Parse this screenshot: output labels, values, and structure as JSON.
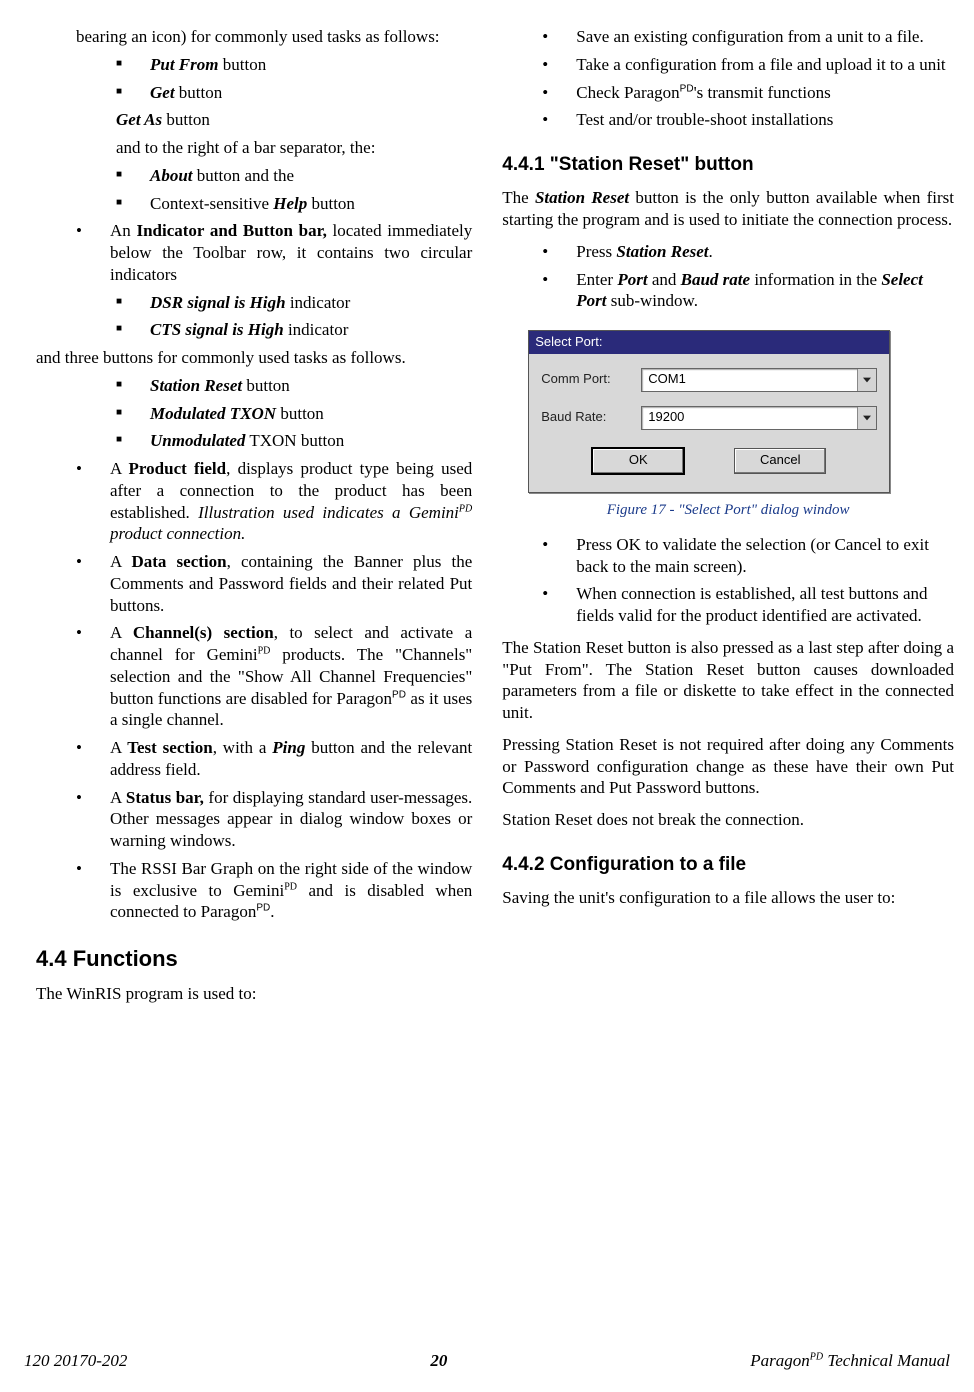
{
  "left": {
    "intro": "bearing an icon) for commonly used tasks as follows:",
    "sq_items": [
      {
        "html": "<span class='bi'>Put From</span> button"
      },
      {
        "html": "<span class='bi'>Get</span> button"
      }
    ],
    "plain1": {
      "html": "<span class='bi'>Get As</span> button"
    },
    "plain2": "and to the right of a bar separator, the:",
    "sq_items2": [
      {
        "html": "<span class='bi'>About</span> button and the"
      },
      {
        "html": "Context-sensitive <span class='bi'>Help</span> button"
      }
    ],
    "bullet1": {
      "html": "An <b>Indicator and Button bar,</b> located immediately below the Toolbar row, it contains two circular indicators"
    },
    "sq_items3": [
      {
        "html": "<span class='bi'>DSR signal is High</span> indicator"
      },
      {
        "html": "<span class='bi'>CTS signal is High</span> indicator"
      }
    ],
    "plain3": "and three buttons for commonly used tasks as follows.",
    "sq_items4": [
      {
        "html": "<span class='bi'>Station Reset</span> button"
      },
      {
        "html": "<span class='bi'>Modulated TXON</span> button"
      },
      {
        "html": "<span class='bi'>Unmodulated</span> TXON button"
      }
    ],
    "bullets_rest": [
      {
        "html": "A <b>Product field</b>, displays product type being used after a connection to the product has been established. <i>Illustration used indicates a Gemini<sup class='pd'>PD</sup> product connection.</i>"
      },
      {
        "html": "A <b>Data section</b>, containing the Banner plus the Comments and Password fields and their related Put buttons."
      },
      {
        "html": "A <b>Channel(s) section</b>, to select and activate a channel for Gemini<sup class='pd'>PD</sup> products. The \"Channels\" selection and the \"Show All Channel Frequencies\" button functions are disabled for Paragon<sup class='pds'>PD</sup> as it uses a single channel."
      },
      {
        "html": "A <b>Test section</b>, with a <b><i>Ping</i></b> button and the relevant address field."
      },
      {
        "html": "A <b>Status bar,</b> for displaying standard user-messages. Other messages appear in dialog window boxes or warning windows."
      },
      {
        "html": "The RSSI Bar Graph on the right side of the window is exclusive to Gemini<sup class='pd'>PD</sup> and is disabled when connected to Paragon<sup class='pds'>PD</sup>."
      }
    ],
    "h2": "4.4    Functions",
    "p_func": "The WinRIS program is used to:"
  },
  "right": {
    "bullets_top": [
      "Save an existing configuration from a unit to a file.",
      "Take a configuration from a file and upload it to a unit",
      {
        "html": "Check Paragon<sup class='pds'>PD</sup>'s transmit functions"
      },
      "Test and/or trouble-shoot installations"
    ],
    "h3_1": "4.4.1   \"Station Reset\" button",
    "p1": {
      "html": "The <b><i>Station Reset</i></b> button is the only button available when first starting the program and is used to initiate the connection process."
    },
    "bullets_mid": [
      {
        "html": "Press <b><i>Station Reset</i></b>."
      },
      {
        "html": "Enter <b><i>Port</i></b> and <b><i>Baud rate</i></b> information in the <b><i>Select Port</i></b> sub-window."
      }
    ],
    "dlg": {
      "title": "Select Port:",
      "comm_label": "Comm Port:",
      "comm_value": "COM1",
      "baud_label": "Baud Rate:",
      "baud_value": "19200",
      "ok": "OK",
      "cancel": "Cancel"
    },
    "figcaption": "Figure 17 - \"Select Port\" dialog window",
    "bullets_after": [
      "Press OK to validate the selection (or Cancel to exit back to the main screen).",
      "When connection is established, all test buttons and fields valid for the product identified are activated."
    ],
    "p2": "The Station Reset button is also pressed as a last step after doing a \"Put From\". The Station Reset button causes downloaded parameters from a file or diskette to take effect in the connected unit.",
    "p3": "Pressing Station Reset is not required after doing any Comments or Password configuration change as these have their own Put Comments and Put Password buttons.",
    "p4": "Station Reset does not break the connection.",
    "h3_2": "4.4.2   Configuration to a file",
    "p5": "Saving the unit's configuration to a file allows the user to:"
  },
  "footer": {
    "doc": "120 20170-202",
    "page": "20",
    "manual_html": "Paragon<sup class='pd'>PD</sup> Technical Manual"
  }
}
